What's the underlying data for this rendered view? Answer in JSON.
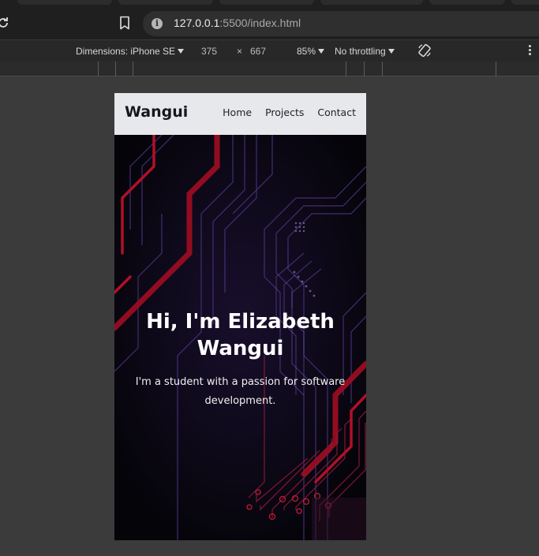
{
  "browser": {
    "url_host": "127.0.0.1",
    "url_path": ":5500/index.html"
  },
  "devtools": {
    "dimensions_label": "Dimensions: iPhone SE",
    "width": "375",
    "times": "×",
    "height": "667",
    "zoom": "85%",
    "throttling": "No throttling"
  },
  "site": {
    "brand": "Wangui",
    "nav": [
      "Home",
      "Projects",
      "Contact"
    ],
    "hero_title_line1": "Hi, I'm Elizabeth",
    "hero_title_line2": "Wangui",
    "hero_subtitle": "I'm a student with a passion for software development."
  },
  "colors": {
    "circuit_red": "#b01028",
    "circuit_purple": "#5a3d8f",
    "navbar_bg": "#e7e8ec"
  }
}
